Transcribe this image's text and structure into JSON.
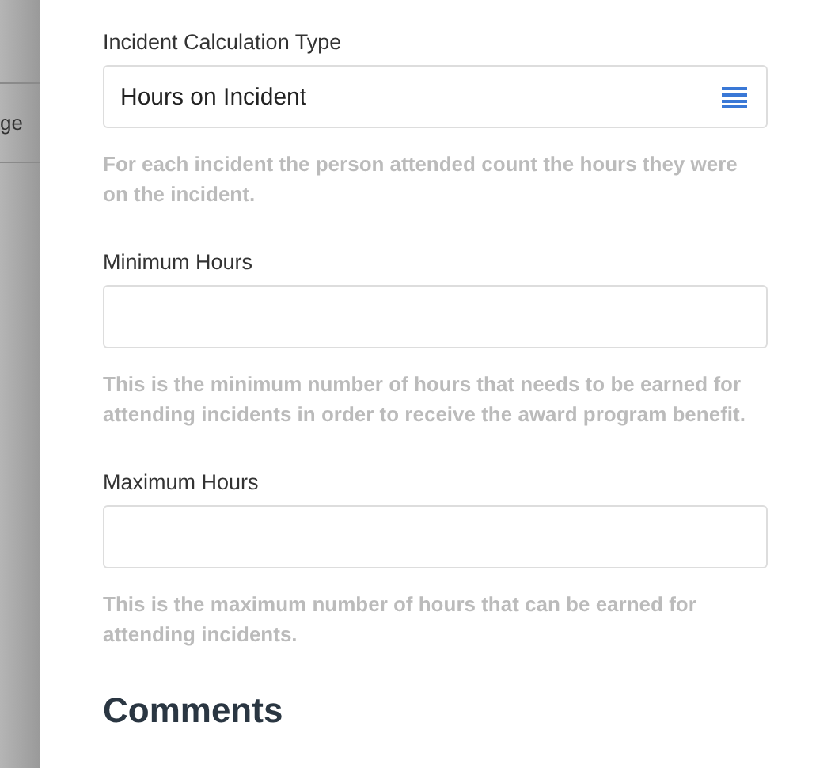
{
  "sidebar": {
    "items": [
      {
        "label": "ge"
      }
    ]
  },
  "fields": [
    {
      "kind": "select",
      "label": "Incident Calculation Type",
      "value": "Hours on Incident",
      "help": "For each incident the person attended count the hours they were on the incident."
    },
    {
      "kind": "input",
      "label": "Minimum Hours",
      "help": "This is the minimum number of hours that needs to be earned for attending incidents in order to receive the award program benefit."
    },
    {
      "kind": "input",
      "label": "Maximum Hours",
      "help": "This is the maximum number of hours that can be earned for attending incidents."
    }
  ],
  "section_heading": "Comments"
}
